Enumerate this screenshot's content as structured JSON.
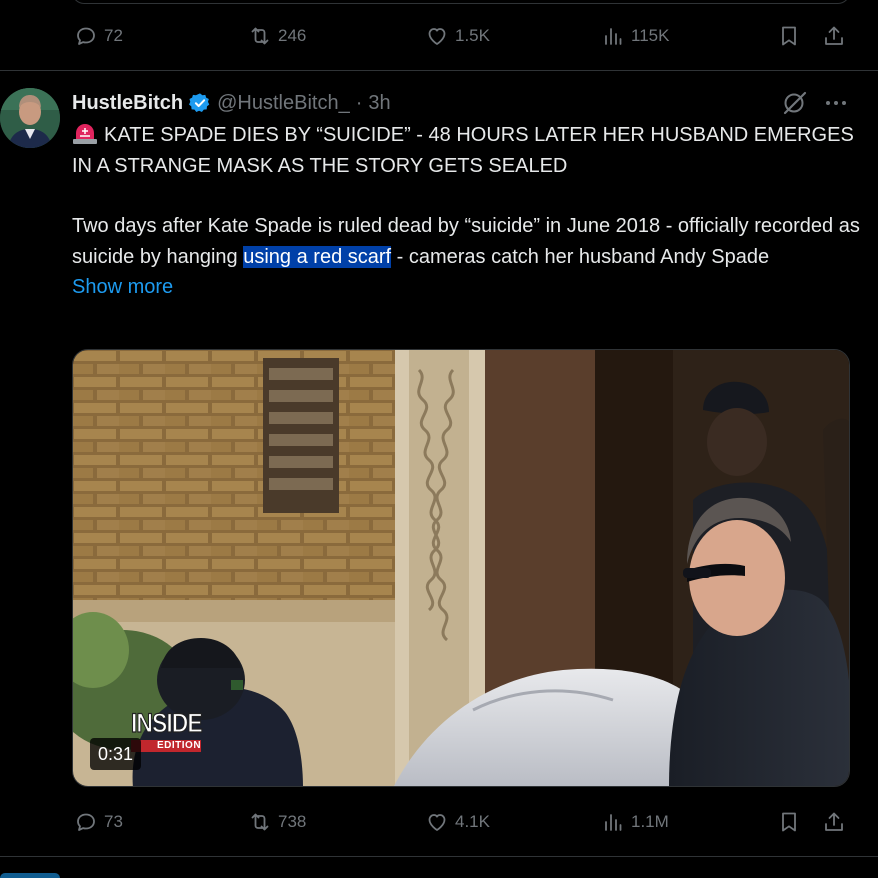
{
  "prev_post": {
    "actions": {
      "replies": "72",
      "reposts": "246",
      "likes": "1.5K",
      "views": "115K"
    }
  },
  "post": {
    "author_name": "HustleBitch",
    "verified": true,
    "handle": "@HustleBitch_",
    "separator": "·",
    "time": "3h",
    "headline": "KATE SPADE DIES BY “SUICIDE” - 48 HOURS LATER HER HUSBAND EMERGES IN A STRANGE MASK AS THE STORY GETS SEALED",
    "body_before": "Two days after Kate Spade is ruled dead by “suicide” in June 2018 - officially recorded as suicide by hanging ",
    "body_highlight": "using a red scarf",
    "body_after": " - cameras catch her husband Andy Spade",
    "show_more": "Show more",
    "video": {
      "watermark_top": "INSIDE",
      "watermark_bottom": "EDITION",
      "duration": "0:31"
    },
    "actions": {
      "replies": "73",
      "reposts": "738",
      "likes": "4.1K",
      "views": "1.1M"
    }
  },
  "icons": {
    "reply": "reply-icon",
    "repost": "repost-icon",
    "like": "like-icon",
    "views": "views-icon",
    "bookmark": "bookmark-icon",
    "share": "share-icon",
    "verified": "verified-badge-icon",
    "grok": "grok-icon",
    "more": "more-icon",
    "siren": "siren-emoji-icon"
  },
  "colors": {
    "background": "#000000",
    "text": "#e7e9ea",
    "muted": "#71767b",
    "accent": "#1d9bf0",
    "highlight": "#0040a8",
    "divider": "#2f3336"
  }
}
